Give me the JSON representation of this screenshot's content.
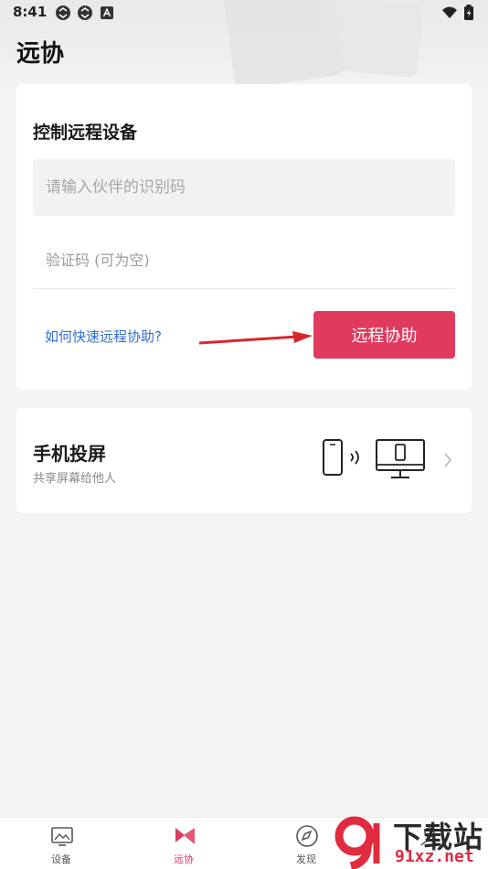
{
  "status_bar": {
    "time": "8:41",
    "left_icons": [
      "sync-icon",
      "sync-icon",
      "app-a-icon"
    ],
    "right_icons": [
      "wifi-icon",
      "battery-icon"
    ]
  },
  "page": {
    "title": "远协"
  },
  "remote_card": {
    "title": "控制远程设备",
    "partner_id_placeholder": "请输入伙伴的识别码",
    "verify_code_placeholder": "验证码 (可为空)",
    "help_link": "如何快速远程协助?",
    "action_button": "远程协助",
    "accent_color": "#e03a5f",
    "link_color": "#2f6fd6"
  },
  "cast_card": {
    "title": "手机投屏",
    "subtitle": "共享屏幕给他人",
    "illustration": "phone-to-monitor-cast-icon"
  },
  "bottom_nav": {
    "items": [
      {
        "label": "设备",
        "icon": "devices-icon",
        "active": false
      },
      {
        "label": "远协",
        "icon": "remote-assist-icon",
        "active": true
      },
      {
        "label": "发现",
        "icon": "compass-icon",
        "active": false
      },
      {
        "label": "",
        "icon": "profile-icon",
        "active": false
      }
    ]
  },
  "watermark": {
    "top": "下载站",
    "bottom": "91xz.net"
  }
}
